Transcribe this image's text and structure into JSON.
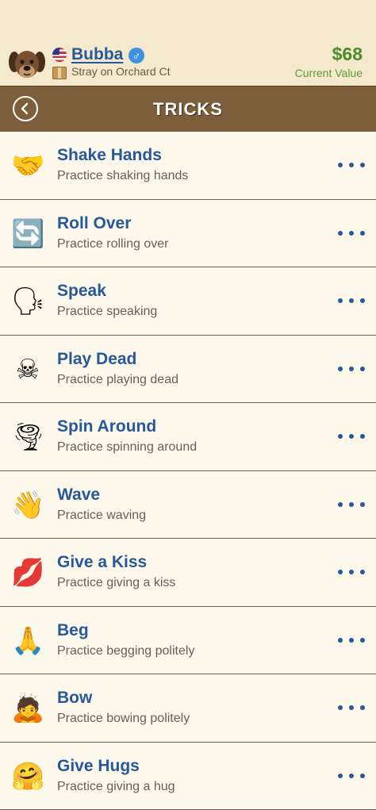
{
  "header": {
    "pet_name": "Bubba",
    "gender_symbol": "♂",
    "status": "Stray on Orchard Ct",
    "value": "$68",
    "value_label": "Current Value",
    "avatar_icon": "dog-face-icon",
    "flag_icon": "us-flag-icon",
    "status_icon": "box-icon"
  },
  "titlebar": {
    "title": "TRICKS",
    "back_icon": "chevron-left-icon"
  },
  "tricks": [
    {
      "name": "Shake Hands",
      "desc": "Practice shaking hands",
      "emoji": "🤝",
      "icon": "handshake-icon"
    },
    {
      "name": "Roll Over",
      "desc": "Practice rolling over",
      "emoji": "🔄",
      "icon": "arrows-cycle-icon"
    },
    {
      "name": "Speak",
      "desc": "Practice speaking",
      "emoji": "🗣",
      "icon": "speaking-head-icon"
    },
    {
      "name": "Play Dead",
      "desc": "Practice playing dead",
      "emoji": "☠",
      "icon": "skull-crossbones-icon"
    },
    {
      "name": "Spin Around",
      "desc": "Practice spinning around",
      "emoji": "🌪",
      "icon": "tornado-icon"
    },
    {
      "name": "Wave",
      "desc": "Practice waving",
      "emoji": "👋",
      "icon": "waving-hand-icon"
    },
    {
      "name": "Give a Kiss",
      "desc": "Practice giving a kiss",
      "emoji": "💋",
      "icon": "kiss-lips-icon"
    },
    {
      "name": "Beg",
      "desc": "Practice begging politely",
      "emoji": "🙏",
      "icon": "praying-hands-icon"
    },
    {
      "name": "Bow",
      "desc": "Practice bowing politely",
      "emoji": "🙇",
      "icon": "bowing-person-icon"
    },
    {
      "name": "Give Hugs",
      "desc": "Practice giving a hug",
      "emoji": "🤗",
      "icon": "hugging-face-icon"
    }
  ]
}
